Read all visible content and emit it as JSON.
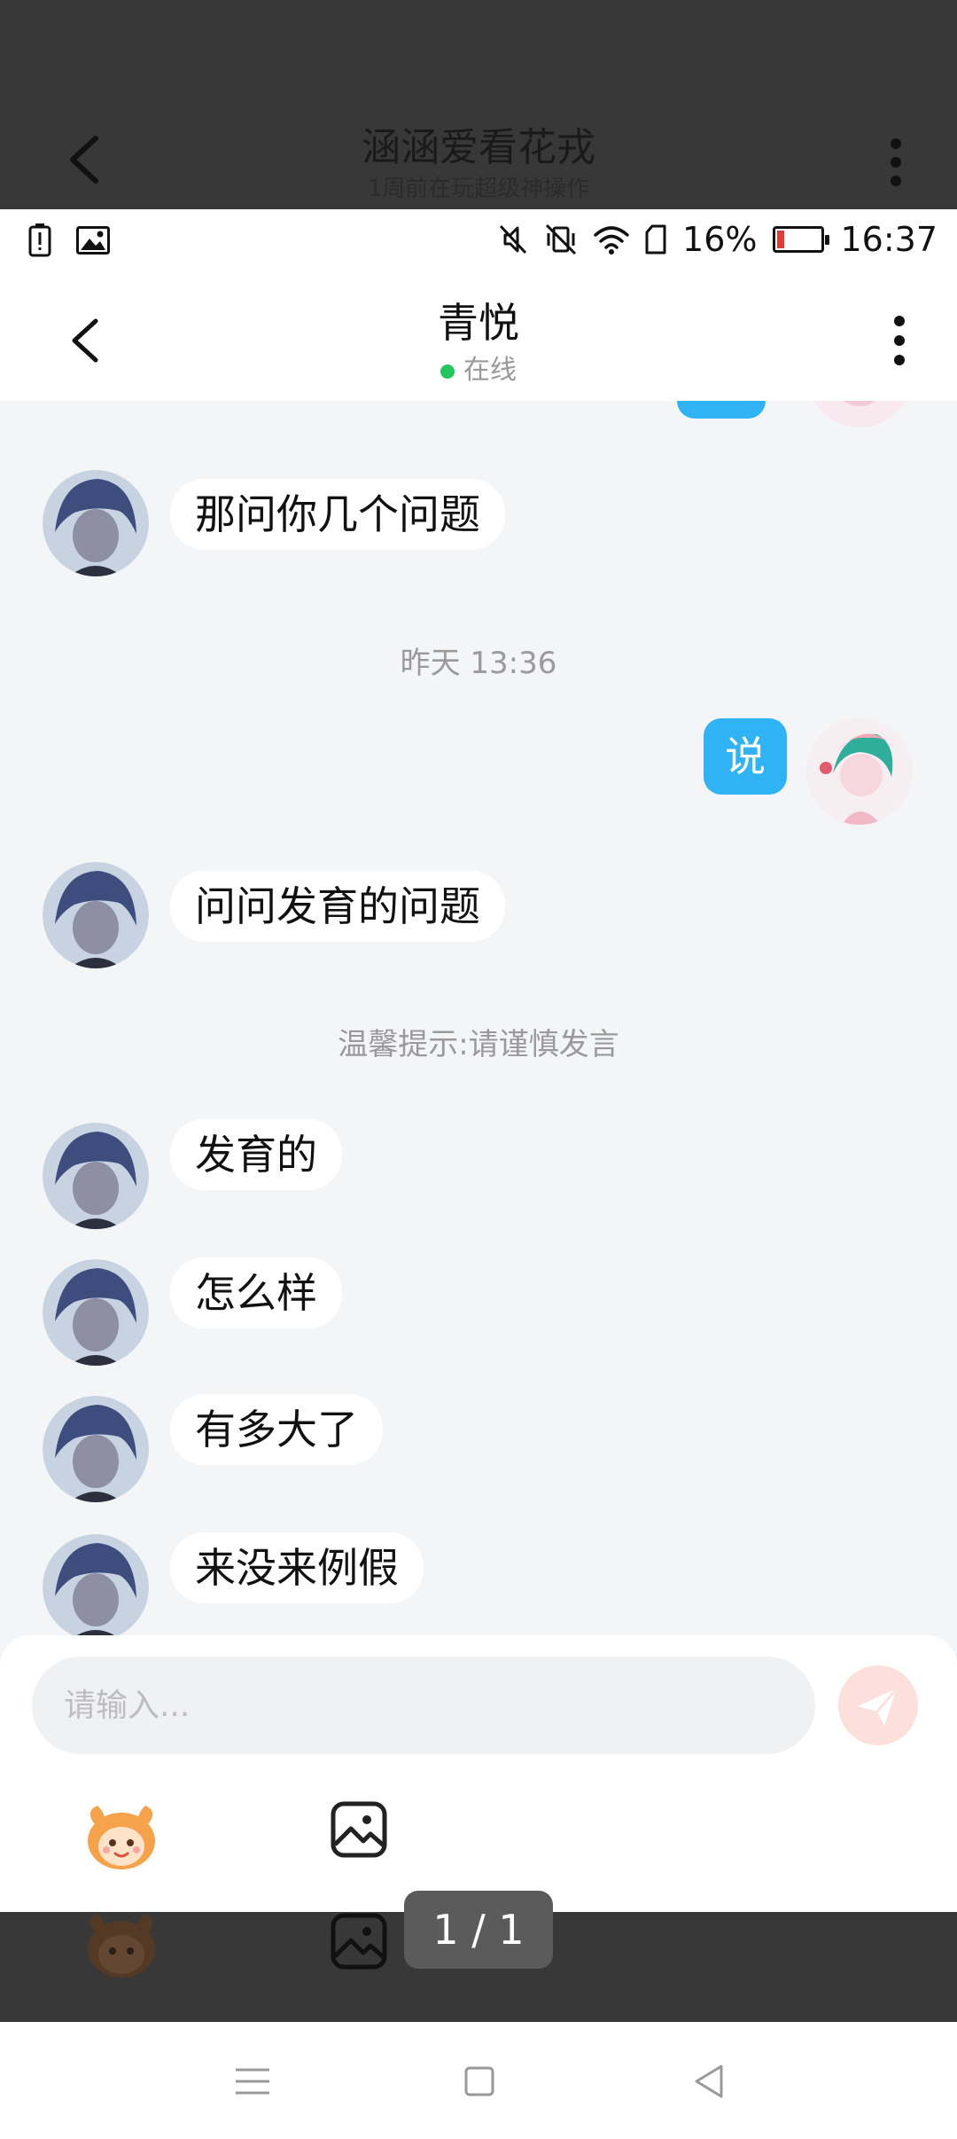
{
  "viewer": {
    "title": "涵涵爱看花戎",
    "subtitle": "1周前在玩超级神操作",
    "page_counter": "1 / 1"
  },
  "status_bar": {
    "battery_percent": "16%",
    "time": "16:37",
    "battery_level": 0.16,
    "icons": [
      "battery-alert-icon",
      "image-icon",
      "mute-icon",
      "vibrate-off-icon",
      "wifi-icon",
      "sim-icon",
      "battery-icon"
    ]
  },
  "chat": {
    "contact_name": "青悦",
    "online_status": "在线",
    "messages": [
      {
        "from": "other",
        "text": "那问你几个问题"
      },
      {
        "type": "timestamp",
        "text": "昨天 13:36"
      },
      {
        "from": "me",
        "text": "说"
      },
      {
        "from": "other",
        "text": "问问发育的问题"
      },
      {
        "type": "notice",
        "text": "温馨提示:请谨慎发言"
      },
      {
        "from": "other",
        "text": "发育的"
      },
      {
        "from": "other",
        "text": "怎么样"
      },
      {
        "from": "other",
        "text": "有多大了"
      },
      {
        "from": "other",
        "text": "来没来例假"
      }
    ]
  },
  "input": {
    "placeholder": "请输入..."
  },
  "colors": {
    "accent_blue": "#2fb3f5",
    "online_green": "#22c55e",
    "send_button": "#fde0dc",
    "battery_low": "#e53935"
  }
}
